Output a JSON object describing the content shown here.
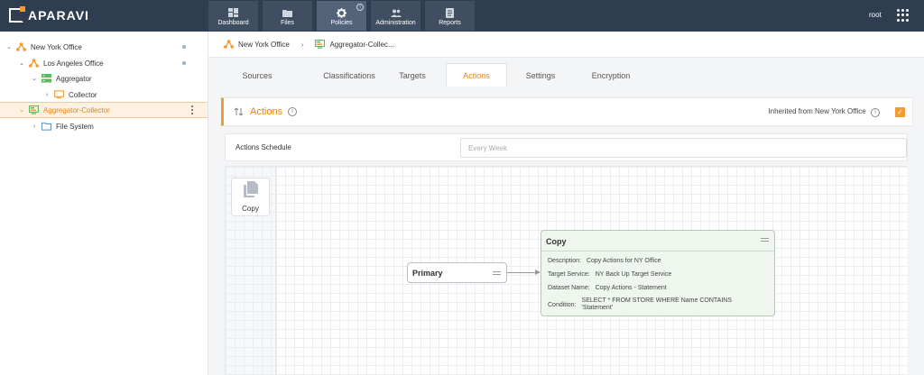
{
  "app": {
    "logo_text": "APARAVI",
    "user": "root"
  },
  "nav": {
    "tabs": [
      {
        "label": "Dashboard",
        "icon": "dashboard-icon"
      },
      {
        "label": "Files",
        "icon": "folder-icon"
      },
      {
        "label": "Policies",
        "icon": "gear-icon",
        "active": true
      },
      {
        "label": "Administration",
        "icon": "users-icon"
      },
      {
        "label": "Reports",
        "icon": "report-icon"
      }
    ]
  },
  "sidebar": {
    "items": [
      {
        "label": "New York Office",
        "icon": "network-icon",
        "expanded": true
      },
      {
        "label": "Los Angeles Office",
        "icon": "network-icon",
        "expanded": true
      },
      {
        "label": "Aggregator",
        "icon": "server-icon",
        "expanded": true
      },
      {
        "label": "Collector",
        "icon": "monitor-icon",
        "expanded": false
      },
      {
        "label": "Aggregator-Collector",
        "icon": "aggregator-collector-icon",
        "selected": true
      },
      {
        "label": "File System",
        "icon": "folder-icon",
        "expanded": false
      }
    ]
  },
  "breadcrumb": {
    "items": [
      "New York Office",
      "Aggregator-Collec..."
    ]
  },
  "tabs": {
    "items": [
      "Sources",
      "Classifications",
      "Targets",
      "Actions",
      "Settings",
      "Encryption"
    ],
    "active": "Actions"
  },
  "panel": {
    "title": "Actions",
    "inherited_label": "Inherited from New York Office",
    "inherited_checked": true
  },
  "schedule": {
    "label": "Actions Schedule",
    "placeholder": "Every Week"
  },
  "palette": {
    "copy_label": "Copy"
  },
  "diagram": {
    "primary_label": "Primary",
    "copy_node": {
      "title": "Copy",
      "fields": [
        {
          "key": "Description:",
          "value": "Copy Actions for NY Office"
        },
        {
          "key": "Target Service:",
          "value": "NY Back Up Target Service"
        },
        {
          "key": "Dataset Name:",
          "value": "Copy Actions - Statement"
        },
        {
          "key": "Condition:",
          "value": "SELECT * FROM STORE WHERE Name CONTAINS 'Statement'"
        }
      ]
    }
  },
  "colors": {
    "accent": "#f29b30",
    "topbar": "#2e3d4f",
    "node_green": "#eef6ee"
  }
}
